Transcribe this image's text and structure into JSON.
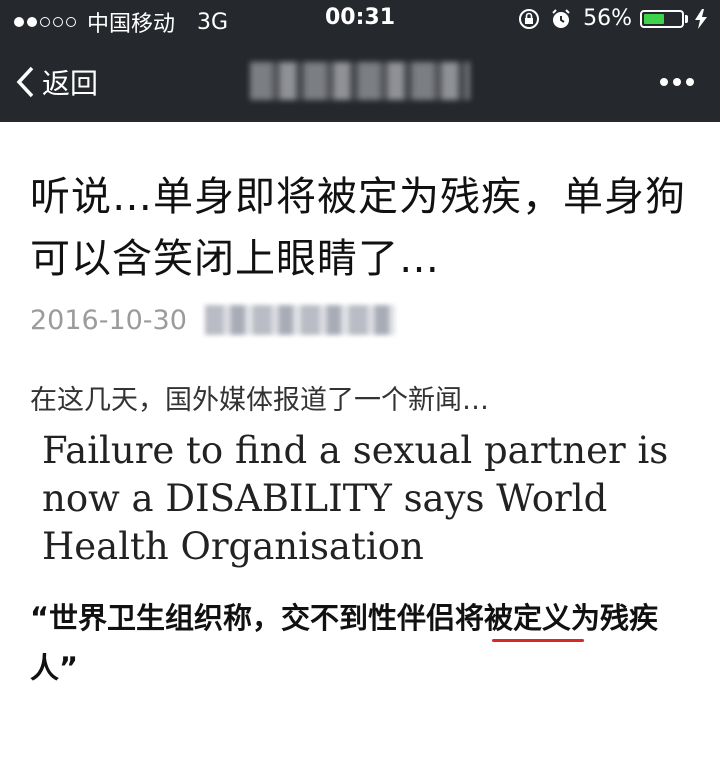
{
  "status": {
    "carrier": "中国移动",
    "network": "3G",
    "time": "00:31",
    "battery": "56%",
    "battery_level": 0.56,
    "battery_color": "#3fd34b"
  },
  "nav": {
    "back_label": "返回"
  },
  "article": {
    "title": "听说…单身即将被定为残疾，单身狗可以含笑闭上眼睛了…",
    "date": "2016-10-30",
    "intro": "在这几天，国外媒体报道了一个新闻…",
    "headline_image_text": "Failure to find a sexual partner is now a DISABILITY says World Health Organisation",
    "caption": "“世界卫生组织称，交不到性伴侣将被定义为残疾人”"
  }
}
